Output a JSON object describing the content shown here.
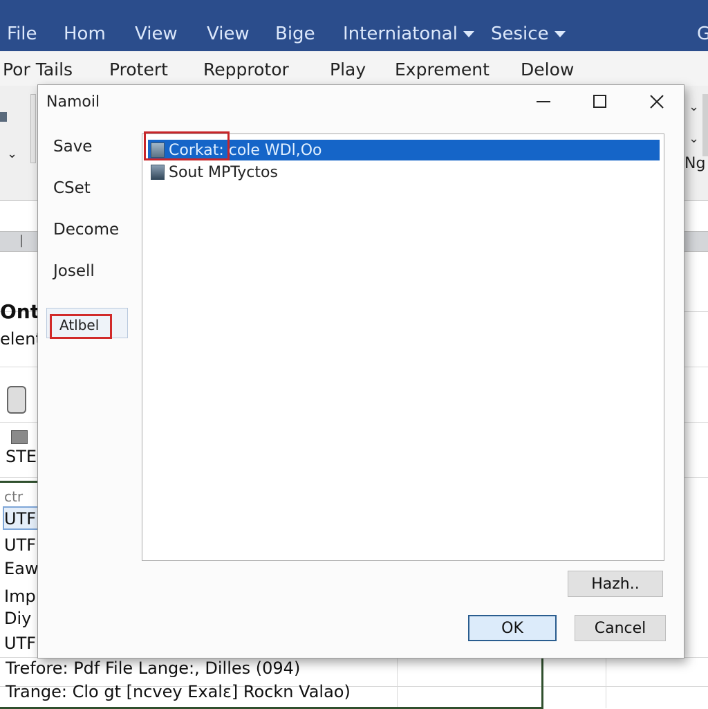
{
  "menubar": {
    "items": [
      "File",
      "Hom",
      "View",
      "View",
      "Bige"
    ],
    "dropdowns": [
      "Interniatonal",
      "Sesice"
    ],
    "partial_right": "G"
  },
  "ribbon_tabs": [
    "Por Tails",
    "Protert",
    "Repprotor",
    "Play",
    "Exprement",
    "Delow"
  ],
  "ribbon": {
    "right_label": "Ng"
  },
  "sheet": {
    "left_bold": "Ont",
    "left_sub": "elent",
    "left_ste": "STE",
    "left_rows": [
      "ctr",
      "UTF",
      "UTF",
      "Eaw",
      "Imp",
      "Diy",
      "UTF"
    ],
    "footer_lines": [
      "Trefore: Pdf File Lange:, Dilles (094)",
      "Trange: Clo gt [ncvey Exalɛ] Rockn Valao)"
    ]
  },
  "dialog": {
    "title": "Namoil",
    "nav": [
      "Save",
      "CSet",
      "Decome",
      "Josell"
    ],
    "nav_active": "Atlbel",
    "files": [
      {
        "name": "Corkat: cole WDl,Oo",
        "selected": true,
        "highlighted": true
      },
      {
        "name": "Sout MPTyctos",
        "selected": false,
        "highlighted": false
      }
    ],
    "buttons": {
      "hash": "Hazh..",
      "ok": "OK",
      "cancel": "Cancel"
    }
  },
  "colors": {
    "menubar": "#2b4d8c",
    "selection": "#1565c8",
    "highlight_red": "#c8262a"
  }
}
